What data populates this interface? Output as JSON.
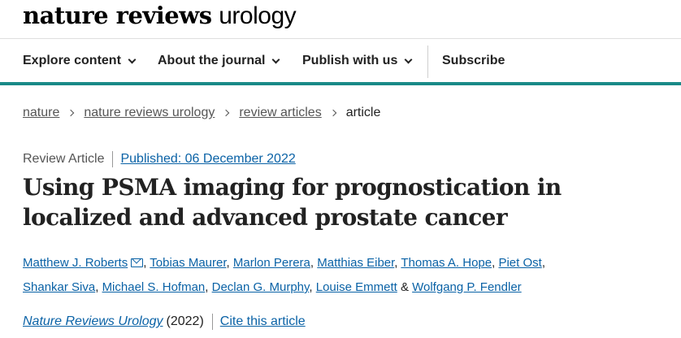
{
  "header": {
    "brand": "nature reviews",
    "journal": "urology"
  },
  "nav": {
    "items": [
      {
        "label": "Explore content"
      },
      {
        "label": "About the journal"
      },
      {
        "label": "Publish with us"
      }
    ],
    "subscribe": "Subscribe"
  },
  "breadcrumb": [
    "nature",
    "nature reviews urology",
    "review articles",
    "article"
  ],
  "article": {
    "type": "Review Article",
    "published": "Published: 06 December 2022",
    "title": "Using PSMA imaging for prognostication in localized and advanced prostate cancer",
    "authors": [
      "Matthew J. Roberts",
      "Tobias Maurer",
      "Marlon Perera",
      "Matthias Eiber",
      "Thomas A. Hope",
      "Piet Ost",
      "Shankar Siva",
      "Michael S. Hofman",
      "Declan G. Murphy",
      "Louise Emmett",
      "Wolfgang P. Fendler"
    ],
    "author_separator": ", ",
    "last_separator": " & ",
    "journal": "Nature Reviews Urology",
    "year": "(2022)",
    "cite": "Cite this article"
  },
  "icons": {
    "email": "email-icon",
    "chevron": "chevron-down-icon",
    "breadcrumb_sep": "chevron-right-icon"
  },
  "colors": {
    "accent": "#1a8a88",
    "link": "#0a62a6",
    "text": "#222222"
  }
}
